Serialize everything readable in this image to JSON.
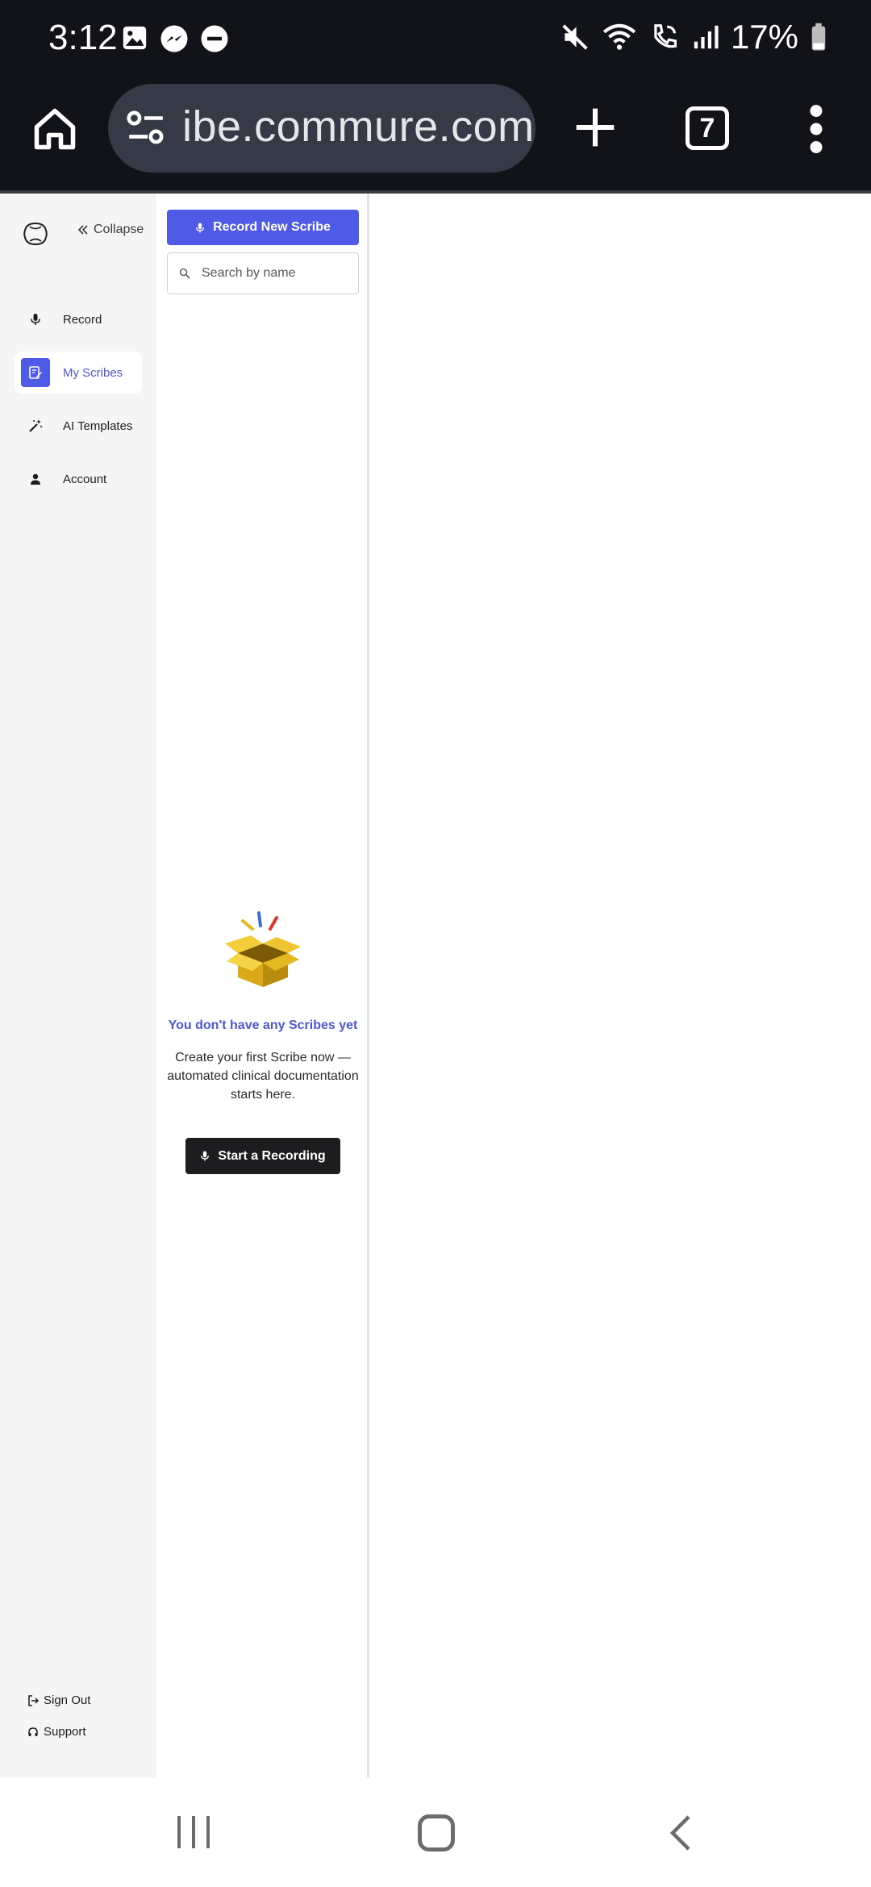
{
  "status_bar": {
    "time": "3:12",
    "battery": "17%",
    "left_icons": [
      "image-icon",
      "messenger-icon",
      "do-not-disturb-icon"
    ],
    "right_icons": [
      "mute-icon",
      "wifi-icon",
      "wifi-calling-icon",
      "signal-icon",
      "battery-icon"
    ]
  },
  "browser": {
    "url": "ibe.commure.com",
    "tab_count": "7"
  },
  "sidebar": {
    "collapse_label": "Collapse",
    "items": [
      {
        "label": "Record",
        "icon": "mic-icon",
        "active": false
      },
      {
        "label": "My Scribes",
        "icon": "edit-document-icon",
        "active": true
      },
      {
        "label": "AI Templates",
        "icon": "magic-wand-icon",
        "active": false
      },
      {
        "label": "Account",
        "icon": "person-icon",
        "active": false
      }
    ],
    "sign_out_label": "Sign Out",
    "support_label": "Support"
  },
  "list_panel": {
    "record_button_label": "Record New Scribe",
    "search_placeholder": "Search by name",
    "empty_title": "You don't have any Scribes yet",
    "empty_description": "Create your first Scribe now — automated clinical documentation starts here.",
    "start_button_label": "Start a Recording"
  },
  "colors": {
    "accent": "#4f5ae6",
    "accent_text": "#4e57cf",
    "dark_button": "#1d1d1f",
    "system_bar": "#121319"
  }
}
